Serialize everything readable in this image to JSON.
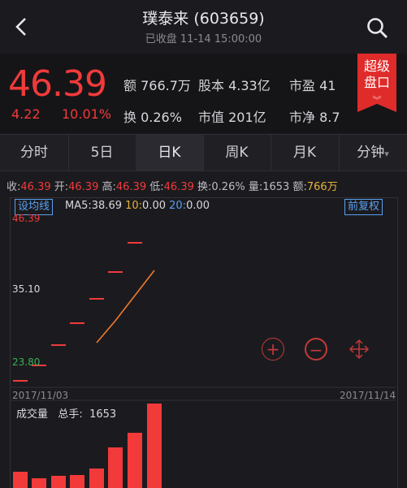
{
  "header": {
    "title": "璞泰来 (603659)",
    "status": "已收盘 11-14 15:00:00"
  },
  "quote": {
    "price": "46.39",
    "change": "4.22",
    "change_pct": "10.01%",
    "amount_label": "额",
    "amount": "766.7万",
    "share_capital_label": "股本",
    "share_capital": "4.33亿",
    "pe_label": "市盈",
    "pe": "41",
    "turnover_label": "换",
    "turnover": "0.26%",
    "market_cap_label": "市值",
    "market_cap": "201亿",
    "pb_label": "市净",
    "pb": "8.7"
  },
  "badge": {
    "line1": "超级",
    "line2": "盘口",
    "chevron": "︾"
  },
  "tabs": [
    "分时",
    "5日",
    "日K",
    "周K",
    "月K",
    "分钟"
  ],
  "tab_dropdown": "▾",
  "ohlc": {
    "close_label": "收:",
    "close": "46.39",
    "open_label": "开:",
    "open": "46.39",
    "high_label": "高:",
    "high": "46.39",
    "low_label": "低:",
    "low": "46.39",
    "turn_label": "换:",
    "turn": "0.26%",
    "vol_label": "量:",
    "vol": "1653",
    "amt_label": "额:",
    "amt": "766万"
  },
  "indicator_button": "设均线",
  "ma": {
    "label": "MA5:",
    "ma5": "38.69",
    "ma10_label": "10:",
    "ma10": "0.00",
    "ma20_label": "20:",
    "ma20": "0.00"
  },
  "adjust_button": "前复权",
  "y_labels": {
    "top": "46.39",
    "mid": "35.10",
    "bottom": "23.80"
  },
  "dates": {
    "start": "2017/11/03",
    "end": "2017/11/14"
  },
  "volume": {
    "label": "成交量",
    "total_label": "总手:",
    "total": "1653"
  },
  "colors": {
    "up": "#f23a3a",
    "ma5": "#f07a2a",
    "accent": "#5aa0f0",
    "down": "#3ab050"
  },
  "icons": {
    "back": "chevron-left-icon",
    "search": "search-icon",
    "zoom_in": "zoom-in-icon",
    "zoom_out": "zoom-out-icon",
    "move": "move-icon"
  }
}
